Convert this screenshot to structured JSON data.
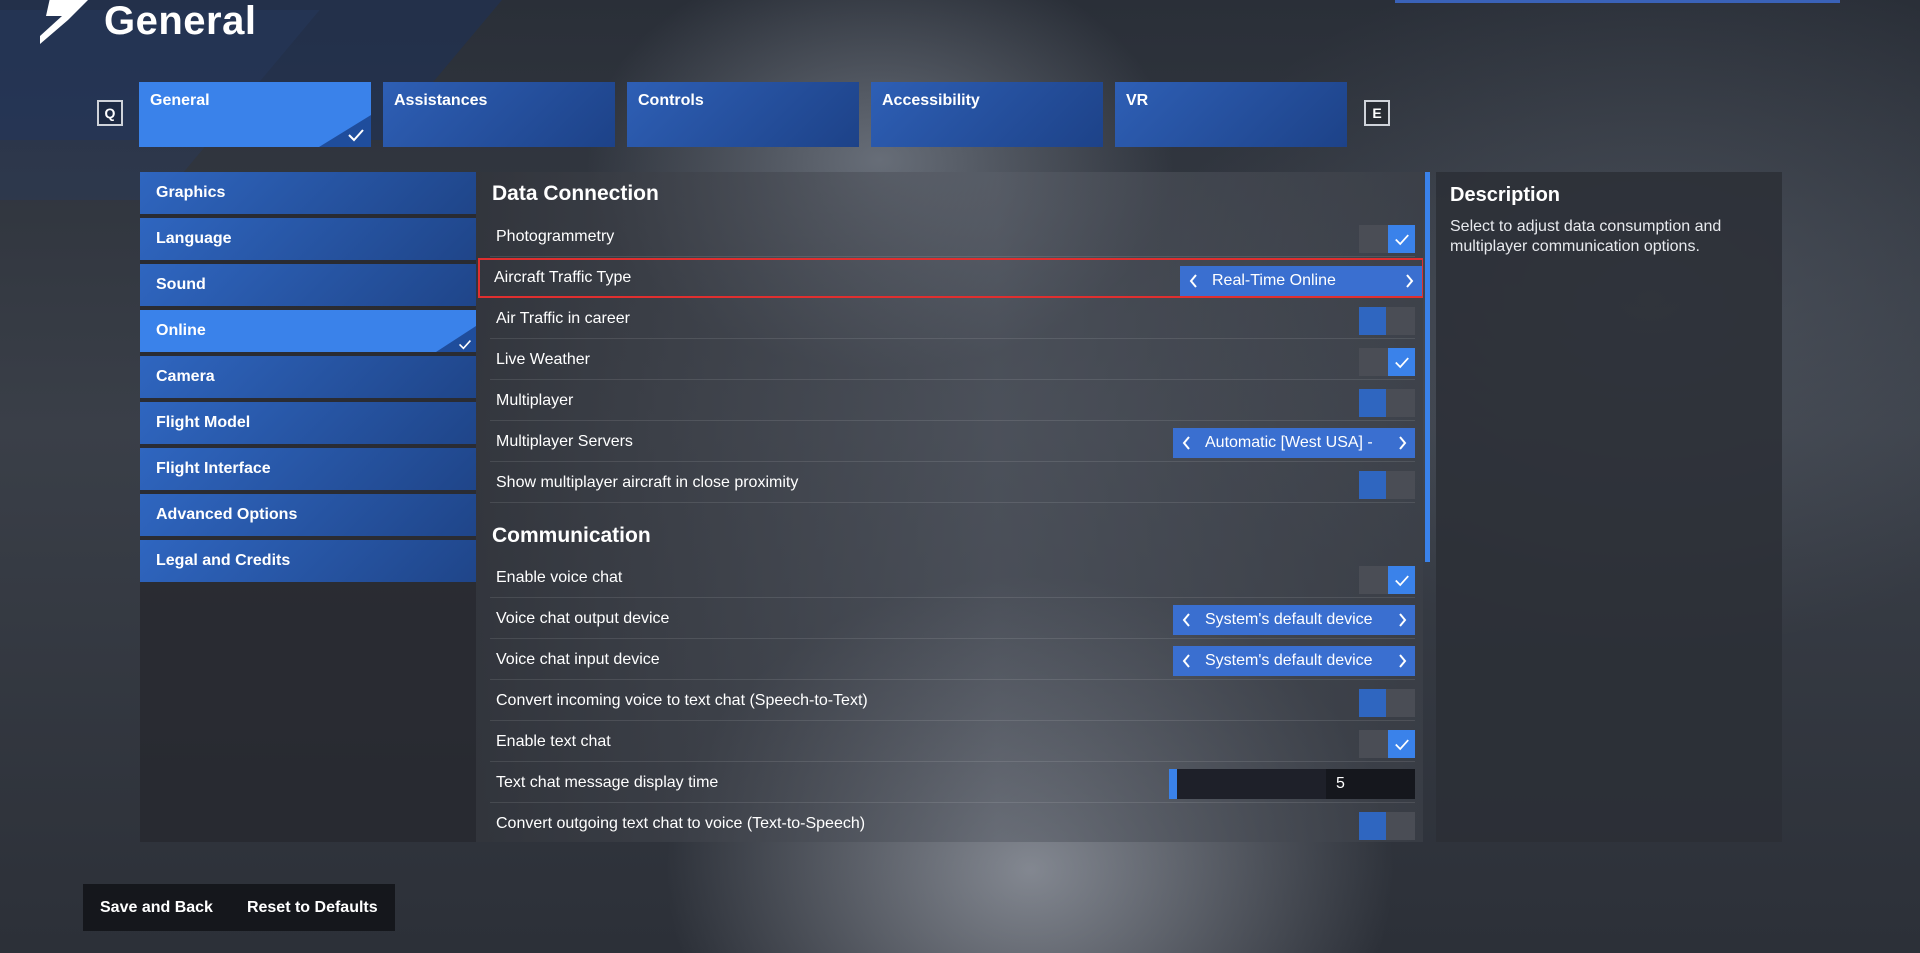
{
  "header": {
    "title": "General"
  },
  "tabs": [
    {
      "label": "General",
      "active": true
    },
    {
      "label": "Assistances"
    },
    {
      "label": "Controls"
    },
    {
      "label": "Accessibility"
    },
    {
      "label": "VR"
    }
  ],
  "keyhints": {
    "prev": "Q",
    "next": "E"
  },
  "sidebar": {
    "items": [
      {
        "label": "Graphics"
      },
      {
        "label": "Language"
      },
      {
        "label": "Sound"
      },
      {
        "label": "Online",
        "active": true
      },
      {
        "label": "Camera"
      },
      {
        "label": "Flight Model"
      },
      {
        "label": "Flight Interface"
      },
      {
        "label": "Advanced Options"
      },
      {
        "label": "Legal and Credits"
      }
    ]
  },
  "main": {
    "sections": [
      {
        "title": "Data Connection",
        "rows": [
          {
            "label": "Photogrammetry",
            "type": "toggle",
            "value": "on"
          },
          {
            "label": "Aircraft Traffic Type",
            "type": "selector",
            "value": "Real-Time Online",
            "highlighted": true
          },
          {
            "label": "Air Traffic in career",
            "type": "toggle",
            "value": "off"
          },
          {
            "label": "Live Weather",
            "type": "toggle",
            "value": "on"
          },
          {
            "label": "Multiplayer",
            "type": "toggle",
            "value": "off"
          },
          {
            "label": "Multiplayer Servers",
            "type": "selector",
            "value": "Automatic [West USA] -"
          },
          {
            "label": "Show multiplayer aircraft in close proximity",
            "type": "toggle",
            "value": "off"
          }
        ]
      },
      {
        "title": "Communication",
        "rows": [
          {
            "label": "Enable voice chat",
            "type": "toggle",
            "value": "on"
          },
          {
            "label": "Voice chat output device",
            "type": "selector",
            "value": "System's default device"
          },
          {
            "label": "Voice chat input device",
            "type": "selector",
            "value": "System's default device"
          },
          {
            "label": "Convert incoming voice to text chat (Speech-to-Text)",
            "type": "toggle",
            "value": "off"
          },
          {
            "label": "Enable text chat",
            "type": "toggle",
            "value": "on"
          },
          {
            "label": "Text chat message display time",
            "type": "slider",
            "value": "5",
            "fraction": 0.0
          },
          {
            "label": "Convert outgoing text chat to voice (Text-to-Speech)",
            "type": "toggle",
            "value": "off"
          }
        ]
      }
    ]
  },
  "description": {
    "title": "Description",
    "body": "Select to adjust data consumption and multiplayer communication options."
  },
  "footer": {
    "save_label": "Save and Back",
    "reset_label": "Reset to Defaults"
  },
  "colors": {
    "accent": "#3a82ea",
    "tab": "#2e5fb5",
    "highlight_border": "#e02f2f"
  },
  "icons": {
    "logo": "chevron-logo-icon",
    "check": "check-icon",
    "prev": "chevron-left-icon",
    "next": "chevron-right-icon"
  }
}
